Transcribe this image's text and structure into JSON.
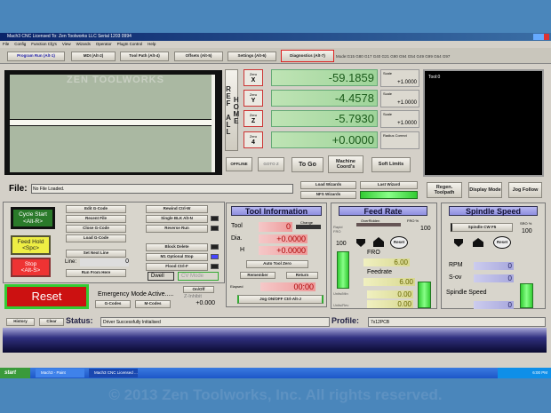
{
  "window": {
    "title": "Mach3 CNC  Licensed To:  Zen Toolworks LLC  Serial 1203 0994"
  },
  "menu": [
    "File",
    "Config",
    "Function Cfg's",
    "View",
    "Wizards",
    "Operator",
    "PlugIn Control",
    "Help"
  ],
  "tabs": [
    {
      "label": "Program Run (Alt-1)"
    },
    {
      "label": "MDI (Alt-2)"
    },
    {
      "label": "Tool Path (Alt-4)"
    },
    {
      "label": "Offsets (Alt-5)"
    },
    {
      "label": "Settings (Alt-6)"
    },
    {
      "label": "Diagnostics (Alt-7)",
      "highlighted": true
    }
  ],
  "modal": "Mode:G15  G80 G17 G40 G21 G90 G94 G54 G49 G99 G64 G97",
  "gcode_watermark": "ZEN TOOLWORKS",
  "ref_all_home": "REF ALL HOME",
  "axes": [
    {
      "zero": "Zero",
      "axis": "X",
      "value": "-59.1859",
      "scale_label": "Scale",
      "scale": "+1.0000"
    },
    {
      "zero": "Zero",
      "axis": "Y",
      "value": "-4.4578",
      "scale_label": "Scale",
      "scale": "+1.0000"
    },
    {
      "zero": "Zero",
      "axis": "Z",
      "value": "-5.7930",
      "scale_label": "Scale",
      "scale": "+1.0000"
    },
    {
      "zero": "Zero",
      "axis": "4",
      "value": "+0.0000",
      "scale_label": "Radius Correct",
      "scale": ""
    }
  ],
  "dro_buttons": {
    "offline": "OFFLINE",
    "gotoz": "GOTO Z",
    "togo": "To Go",
    "machine": "Machine Coord's",
    "soft": "Soft Limits"
  },
  "toolpath": {
    "label": "Tool:0"
  },
  "file": {
    "label": "File:",
    "value": "No File Loaded."
  },
  "wizards": {
    "load": "Load Wizards",
    "last": "Last Wizard",
    "nfs": "NFS Wizards"
  },
  "view_buttons": {
    "regen": "Regen. Toolpath",
    "display": "Display Mode",
    "jog": "Jog Follow"
  },
  "run": {
    "cycle_start": "Cycle Start",
    "cycle_key": "<Alt-R>",
    "feed_hold": "Feed Hold",
    "feed_key": "<Spc>",
    "stop": "Stop",
    "stop_key": "<Alt-S>",
    "edit": "Edit G-Code",
    "recent": "Recent File",
    "close": "Close G-Code",
    "load": "Load G-Code",
    "set_next": "Set Next Line",
    "line_label": "Line:",
    "line_value": "0",
    "run_from": "Run From Here",
    "rewind": "Rewind Ctrl-W",
    "single": "Single BLK Alt-N",
    "reverse": "Reverse Run",
    "block_delete": "Block Delete",
    "m1": "M1 Optional Stop",
    "flood": "Flood Ctrl-F",
    "dwell": "Dwell",
    "cv": "CV Mode"
  },
  "reset": {
    "label": "Reset",
    "emergency": "Emergency Mode Active.....",
    "gcodes": "G-Codes",
    "mcodes": "M-Codes",
    "onoff": "On/Off",
    "zinhibit": "Z-Inhibit",
    "zval": "+0.000"
  },
  "tool_info": {
    "title": "Tool Information",
    "tool_label": "Tool",
    "tool": "0",
    "change": "Change",
    "dia_label": "Dia.",
    "dia": "+0.0000",
    "h_label": "H",
    "h": "+0.0000",
    "auto_zero": "Auto Tool Zero",
    "remember": "Remember",
    "return": "Return",
    "elapsed_label": "Elapsed",
    "elapsed": "00:00",
    "jog": "Jog ON/OFF Ctrl-Alt-J"
  },
  "feed": {
    "title": "Feed Rate",
    "overridden": "OverRidden",
    "fro_pct_label": "FRO %",
    "fro_pct": "100",
    "rapid_label": "Rapid FRO",
    "rapid": "100",
    "reset": "Reset",
    "fro_label": "FRO",
    "fro": "6.00",
    "feedrate_label": "Feedrate",
    "feedrate": "6.00",
    "upm_label": "Units/Min",
    "upm": "0.00",
    "upr_label": "Units/Rev",
    "upr": "0.00"
  },
  "spindle": {
    "title": "Spindle Speed",
    "cw": "Spindle CW F5",
    "sro_label": "SRO %",
    "sro": "100",
    "reset": "Reset",
    "rpm_label": "RPM",
    "rpm": "0",
    "sov_label": "S-ov",
    "sov": "0",
    "speed_label": "Spindle Speed",
    "speed": "0"
  },
  "status": {
    "history": "History",
    "clear": "Clear",
    "label": "Status:",
    "value": "Driver Successfully Initialised",
    "profile_label": "Profile:",
    "profile": "7x12PCB"
  },
  "taskbar": {
    "start": "start",
    "items": [
      "Mach3 - Paint",
      "Mach3 CNC Licensed ..."
    ],
    "clock": "6:00 PM"
  },
  "copyright": "© 2013 Zen Toolworks, Inc. All rights reserved."
}
